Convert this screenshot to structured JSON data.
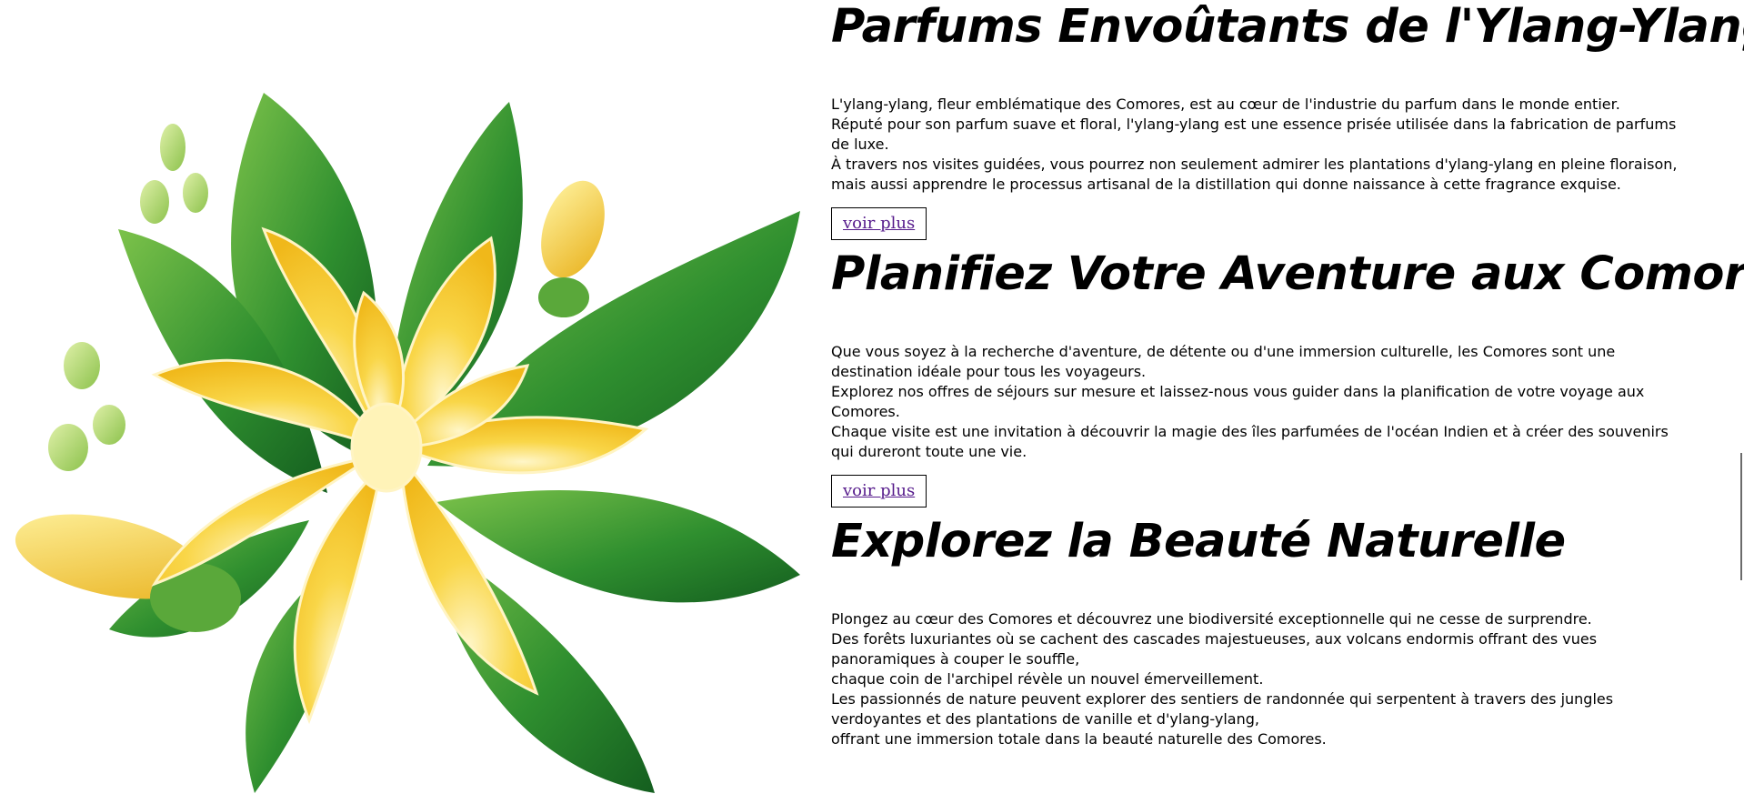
{
  "hero_image": {
    "alt": "Illustration d'une fleur d'ylang-ylang"
  },
  "sections": [
    {
      "title": "Parfums Envoûtants de l'Ylang-Ylang",
      "paragraphs": [
        "L'ylang-ylang, fleur emblématique des Comores, est au cœur de l'industrie du parfum dans le monde entier.",
        "Réputé pour son parfum suave et floral, l'ylang-ylang est une essence prisée utilisée dans la fabrication de parfums de luxe.",
        "À travers nos visites guidées, vous pourrez non seulement admirer les plantations d'ylang-ylang en pleine floraison, mais aussi apprendre le processus artisanal de la distillation qui donne naissance à cette fragrance exquise."
      ],
      "button": "voir plus"
    },
    {
      "title": "Planifiez Votre Aventure aux Comores",
      "paragraphs": [
        "Que vous soyez à la recherche d'aventure, de détente ou d'une immersion culturelle, les Comores sont une destination idéale pour tous les voyageurs.",
        "Explorez nos offres de séjours sur mesure et laissez-nous vous guider dans la planification de votre voyage aux Comores.",
        "Chaque visite est une invitation à découvrir la magie des îles parfumées de l'océan Indien et à créer des souvenirs qui dureront toute une vie."
      ],
      "button": "voir plus"
    },
    {
      "title": "Explorez la Beauté Naturelle",
      "paragraphs": [
        "Plongez au cœur des Comores et découvrez une biodiversité exceptionnelle qui ne cesse de surprendre.",
        "Des forêts luxuriantes où se cachent des cascades majestueuses, aux volcans endormis offrant des vues panoramiques à couper le souffle,",
        "chaque coin de l'archipel révèle un nouvel émerveillement.",
        "Les passionnés de nature peuvent explorer des sentiers de randonnée qui serpentent à travers des jungles verdoyantes et des plantations de vanille et d'ylang-ylang,",
        "offrant une immersion totale dans la beauté naturelle des Comores."
      ]
    }
  ],
  "colors": {
    "link": "#551a8b",
    "leaf": "#2e8b2e",
    "petal": "#f5c518"
  }
}
